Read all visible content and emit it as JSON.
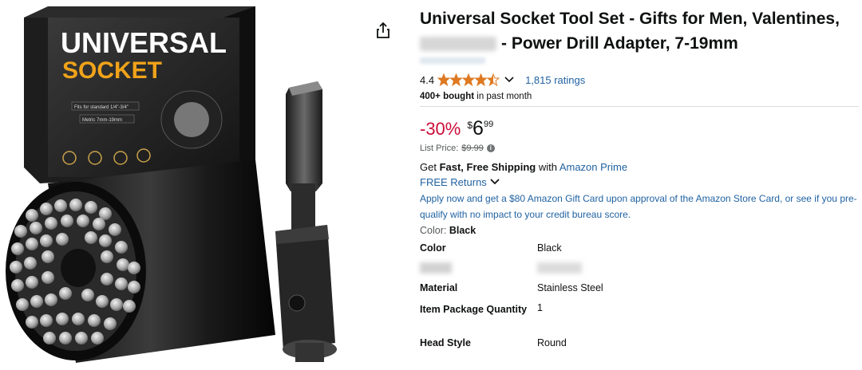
{
  "product": {
    "title_part1": "Universal Socket Tool Set - Gifts for Men, Valentines,",
    "title_part2": "- Power Drill Adapter, 7-19mm",
    "rating": "4.4",
    "ratings_count": "1,815 ratings",
    "bought_bold": "400+ bought",
    "bought_rest": " in past month",
    "discount": "-30%",
    "price_symbol": "$",
    "price_whole": "6",
    "price_fraction": "99",
    "list_price_label": "List Price:",
    "list_price": "$9.99",
    "shipping_prefix": "Get ",
    "shipping_bold": "Fast, Free Shipping",
    "shipping_mid": " with ",
    "shipping_link": "Amazon Prime",
    "returns": "FREE Returns",
    "card_offer": "Apply now and get a $80 Amazon Gift Card upon approval of the Amazon Store Card, or see if you pre-qualify with no impact to your credit bureau score.",
    "color_label": "Color:",
    "color_value": "Black"
  },
  "specs": [
    {
      "key": "Color",
      "value": "Black"
    },
    {
      "key": "",
      "value": ""
    },
    {
      "key": "Material",
      "value": "Stainless Steel"
    },
    {
      "key": "Item Package Quantity",
      "value": "1"
    },
    {
      "key": "Head Style",
      "value": "Round"
    }
  ],
  "image": {
    "box_line1": "UNIVERSAL",
    "box_line2": "SOCKET",
    "box_spec1": "Fits for standard 1/4\"-3/4\"",
    "box_spec2": "Metric 7mm-19mm"
  },
  "colors": {
    "link": "#2162a1",
    "discount": "#cc0c39",
    "star": "#de7921"
  },
  "icons": [
    "share-icon",
    "star-icon",
    "chevron-down-icon",
    "info-icon"
  ]
}
